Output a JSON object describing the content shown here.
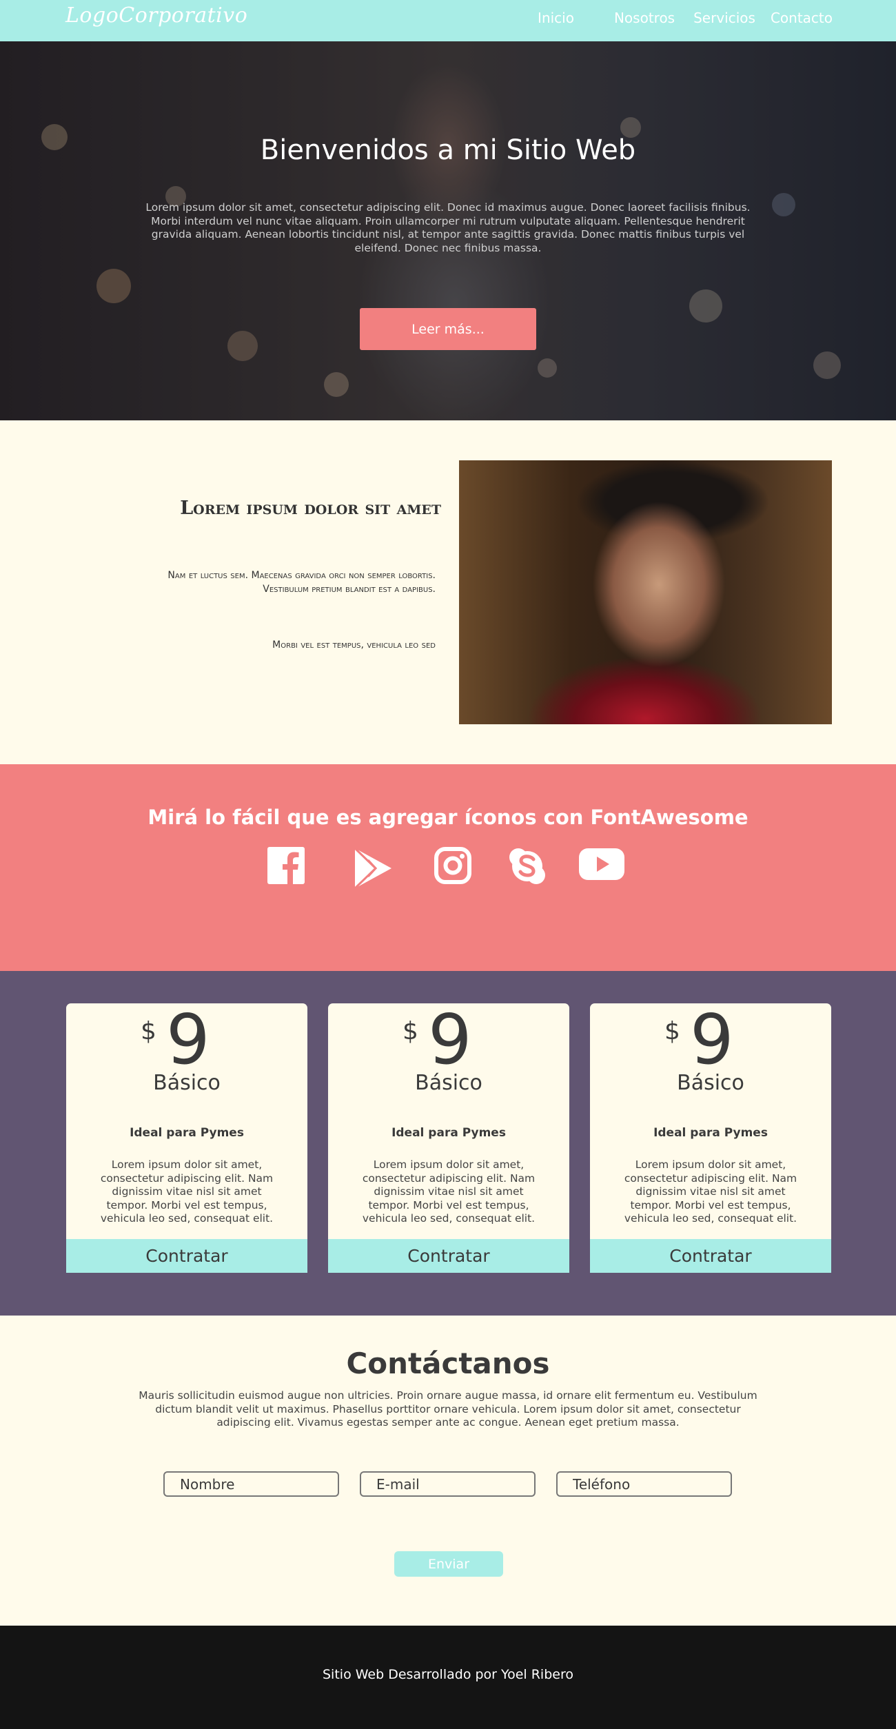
{
  "nav": {
    "logo": "LogoCorporativo",
    "links": [
      "Inicio",
      "Nosotros",
      "Servicios",
      "Contacto"
    ]
  },
  "hero": {
    "title": "Bienvenidos a mi Sitio Web",
    "text": "Lorem ipsum dolor sit amet, consectetur adipiscing elit. Donec id maximus augue. Donec laoreet facilisis finibus. Morbi interdum vel nunc vitae aliquam. Proin ullamcorper mi rutrum vulputate aliquam. Pellentesque hendrerit gravida aliquam. Aenean lobortis tincidunt nisl, at tempor ante sagittis gravida. Donec mattis finibus turpis vel eleifend. Donec nec finibus massa.",
    "button": "Leer más..."
  },
  "about": {
    "title": "Lorem ipsum dolor sit amet",
    "paragraph1": "Nam et luctus sem. Maecenas gravida orci non semper lobortis. Vestibulum pretium blandit est a dapibus.",
    "paragraph2": "Morbi vel est tempus, vehicula leo sed"
  },
  "icons_section": {
    "title": "Mirá lo fácil que es agregar íconos con FontAwesome",
    "icons": [
      "facebook-icon",
      "google-play-icon",
      "instagram-icon",
      "skype-icon",
      "youtube-icon"
    ]
  },
  "pricing": {
    "cards": [
      {
        "currency": "$",
        "price": "9",
        "name": "Básico",
        "subtitle": "Ideal para Pymes",
        "description": "Lorem ipsum dolor sit amet, consectetur adipiscing elit. Nam dignissim vitae nisl sit amet tempor. Morbi vel est tempus, vehicula leo sed, consequat elit.",
        "button": "Contratar"
      },
      {
        "currency": "$",
        "price": "9",
        "name": "Básico",
        "subtitle": "Ideal para Pymes",
        "description": "Lorem ipsum dolor sit amet, consectetur adipiscing elit. Nam dignissim vitae nisl sit amet tempor. Morbi vel est tempus, vehicula leo sed, consequat elit.",
        "button": "Contratar"
      },
      {
        "currency": "$",
        "price": "9",
        "name": "Básico",
        "subtitle": "Ideal para Pymes",
        "description": "Lorem ipsum dolor sit amet, consectetur adipiscing elit. Nam dignissim vitae nisl sit amet tempor. Morbi vel est tempus, vehicula leo sed, consequat elit.",
        "button": "Contratar"
      }
    ]
  },
  "contact": {
    "title": "Contáctanos",
    "text": "Mauris sollicitudin euismod augue non ultricies. Proin ornare augue massa, id ornare elit fermentum eu. Vestibulum dictum blandit velit ut maximus. Phasellus porttitor ornare vehicula. Lorem ipsum dolor sit amet, consectetur adipiscing elit. Vivamus egestas semper ante ac congue. Aenean eget pretium massa.",
    "fields": {
      "name_placeholder": "Nombre",
      "email_placeholder": "E-mail",
      "phone_placeholder": "Teléfono"
    },
    "send_button": "Enviar"
  },
  "footer": {
    "text": "Sitio Web Desarrollado por Yoel Ribero"
  },
  "colors": {
    "nav_bg": "#a8ede6",
    "accent_coral": "#f28080",
    "pricing_bg": "#615572",
    "page_bg": "#fffbeb",
    "footer_bg": "#141414"
  }
}
